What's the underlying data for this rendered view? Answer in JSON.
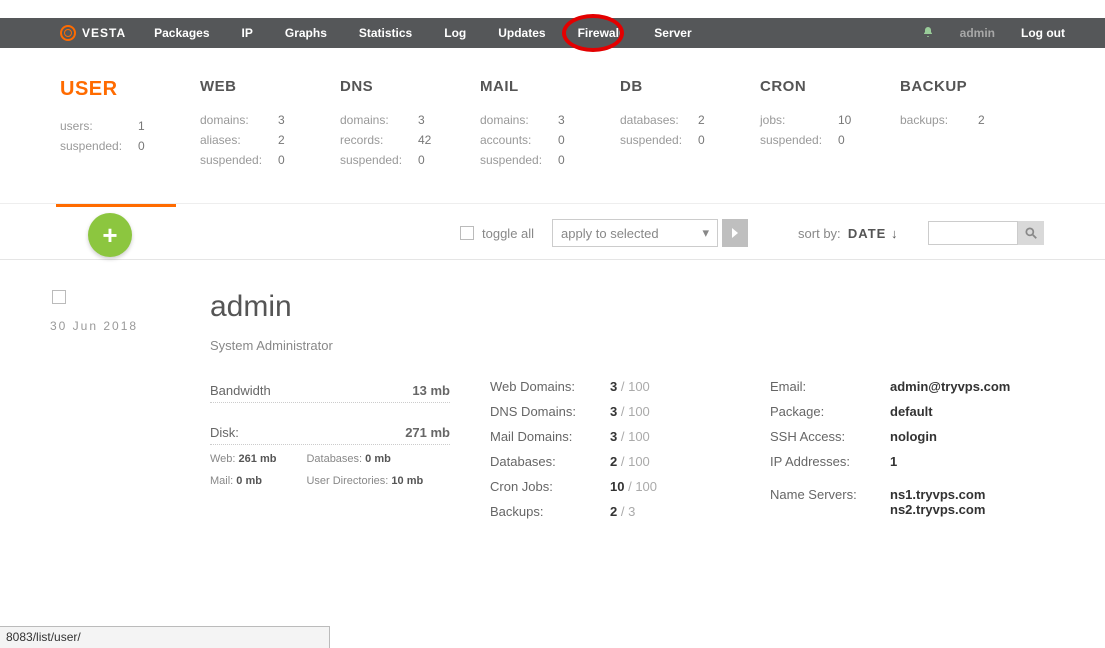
{
  "brand": "VESTA",
  "nav": [
    "Packages",
    "IP",
    "Graphs",
    "Statistics",
    "Log",
    "Updates",
    "Firewall",
    "Server"
  ],
  "session": {
    "user": "admin",
    "logout": "Log out"
  },
  "stats": {
    "user": {
      "title": "USER",
      "lines": [
        [
          "users:",
          "1"
        ],
        [
          "suspended:",
          "0"
        ]
      ]
    },
    "web": {
      "title": "WEB",
      "lines": [
        [
          "domains:",
          "3"
        ],
        [
          "aliases:",
          "2"
        ],
        [
          "suspended:",
          "0"
        ]
      ]
    },
    "dns": {
      "title": "DNS",
      "lines": [
        [
          "domains:",
          "3"
        ],
        [
          "records:",
          "42"
        ],
        [
          "suspended:",
          "0"
        ]
      ]
    },
    "mail": {
      "title": "MAIL",
      "lines": [
        [
          "domains:",
          "3"
        ],
        [
          "accounts:",
          "0"
        ],
        [
          "suspended:",
          "0"
        ]
      ]
    },
    "db": {
      "title": "DB",
      "lines": [
        [
          "databases:",
          "2"
        ],
        [
          "suspended:",
          "0"
        ]
      ]
    },
    "cron": {
      "title": "CRON",
      "lines": [
        [
          "jobs:",
          "10"
        ],
        [
          "suspended:",
          "0"
        ]
      ]
    },
    "backup": {
      "title": "BACKUP",
      "lines": [
        [
          "backups:",
          "2"
        ]
      ]
    }
  },
  "toolbar": {
    "toggle_all": "toggle all",
    "apply": "apply to selected",
    "sort_label": "sort by:",
    "sort_value": "DATE ↓"
  },
  "entry": {
    "date": "30 Jun 2018",
    "name": "admin",
    "role": "System Administrator",
    "bandwidth": {
      "label": "Bandwidth",
      "value": "13 mb"
    },
    "disk": {
      "label": "Disk:",
      "value": "271 mb"
    },
    "disk_sub": [
      [
        "Web:",
        "261 mb"
      ],
      [
        "Databases:",
        "0 mb"
      ],
      [
        "Mail:",
        "0 mb"
      ],
      [
        "User Directories:",
        "10 mb"
      ]
    ],
    "limits": [
      [
        "Web Domains:",
        "3",
        "100"
      ],
      [
        "DNS Domains:",
        "3",
        "100"
      ],
      [
        "Mail Domains:",
        "3",
        "100"
      ],
      [
        "Databases:",
        "2",
        "100"
      ],
      [
        "Cron Jobs:",
        "10",
        "100"
      ],
      [
        "Backups:",
        "2",
        "3"
      ]
    ],
    "info": [
      [
        "Email:",
        "admin@tryvps.com"
      ],
      [
        "Package:",
        "default"
      ],
      [
        "SSH Access:",
        "nologin"
      ],
      [
        "IP Addresses:",
        "1"
      ]
    ],
    "ns_label": "Name Servers:",
    "ns": [
      "ns1.tryvps.com",
      "ns2.tryvps.com"
    ]
  },
  "statusbar": "8083/list/user/"
}
